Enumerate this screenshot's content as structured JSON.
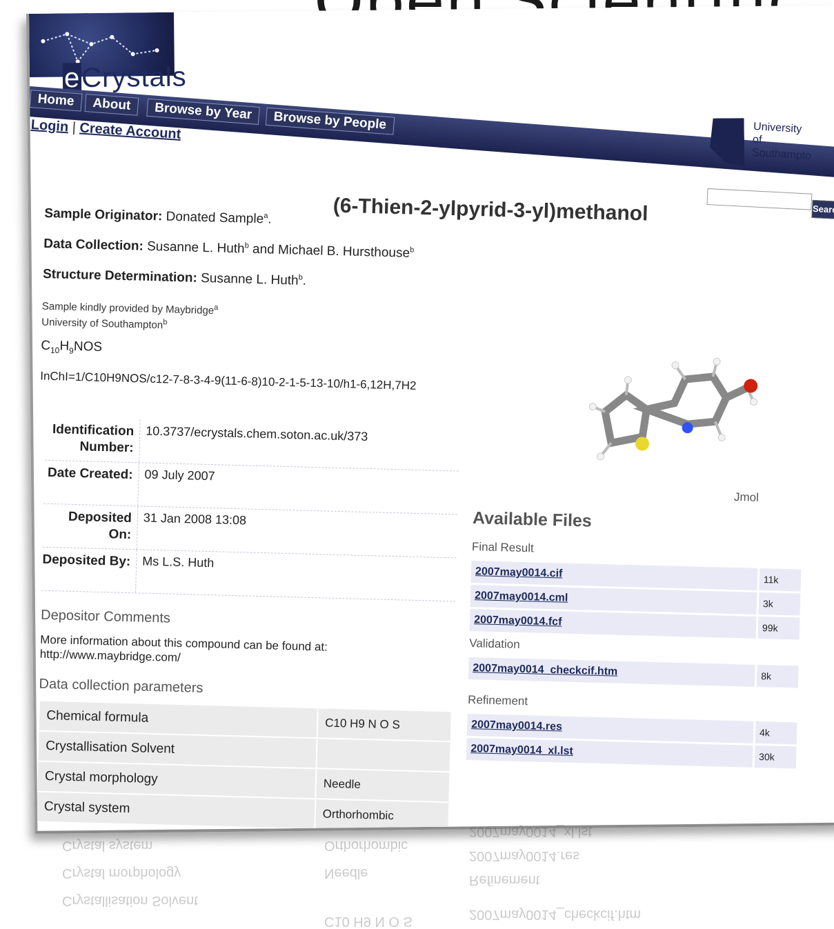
{
  "slide_title": "Open Scientific",
  "site": {
    "logo_text": "Crystals",
    "logo_e": "e"
  },
  "nav": [
    "Home",
    "About",
    "Browse by Year",
    "Browse by People"
  ],
  "account": {
    "login": "Login",
    "separator": "|",
    "create": "Create Account"
  },
  "university": {
    "line1": "University",
    "line2": "of Southampto"
  },
  "search": {
    "button": "Search",
    "placeholder": ""
  },
  "compound_title": "(6-Thien-2-ylpyrid-3-yl)methanol",
  "sample": {
    "originator_label": "Sample Originator:",
    "originator_value": "Donated Sample",
    "originator_sup": "a",
    "collection_label": "Data Collection:",
    "collection_value1": "Susanne L. Huth",
    "collection_sup1": "b",
    "collection_and": "and Michael B. Hursthouse",
    "collection_sup2": "b",
    "structure_label": "Structure Determination:",
    "structure_value": "Susanne L. Huth",
    "structure_sup": "b",
    "affil1": "Sample kindly provided by Maybridge",
    "affil1_sup": "a",
    "affil2": "University of Southampton",
    "affil2_sup": "b"
  },
  "formula": {
    "c": "C",
    "c_n": "10",
    "h": "H",
    "h_n": "9",
    "rest": "NOS"
  },
  "inchi": "InChI=1/C10H9NOS/c12-7-8-3-4-9(11-6-8)10-2-1-5-13-10/h1-6,12H,7H2",
  "meta": [
    {
      "key": "Identification Number:",
      "value": "10.3737/ecrystals.chem.soton.ac.uk/373"
    },
    {
      "key": "Date Created:",
      "value": "09 July 2007"
    },
    {
      "key": "Deposited On:",
      "value": "31 Jan 2008 13:08"
    },
    {
      "key": "Deposited By:",
      "value": "Ms L.S. Huth"
    }
  ],
  "depositor": {
    "heading": "Depositor Comments",
    "body": "More information about this compound can be found at: http://www.maybridge.com/"
  },
  "data_collection": {
    "heading": "Data collection parameters",
    "rows": [
      {
        "label": "Chemical formula",
        "value": "C10 H9 N O S"
      },
      {
        "label": "Crystallisation Solvent",
        "value": ""
      },
      {
        "label": "Crystal morphology",
        "value": "Needle"
      },
      {
        "label": "Crystal system",
        "value": "Orthorhombic"
      }
    ]
  },
  "jmol_label": "Jmol",
  "files": {
    "heading": "Available Files",
    "groups": [
      {
        "name": "Final Result",
        "items": [
          {
            "file": "2007may0014.cif",
            "size": "11k"
          },
          {
            "file": "2007may0014.cml",
            "size": "3k"
          },
          {
            "file": "2007may0014.fcf",
            "size": "99k"
          }
        ]
      },
      {
        "name": "Validation",
        "items": [
          {
            "file": "2007may0014_checkcif.htm",
            "size": "8k"
          }
        ]
      },
      {
        "name": "Refinement",
        "items": [
          {
            "file": "2007may0014.res",
            "size": "4k"
          },
          {
            "file": "2007may0014_xl.lst",
            "size": "30k"
          }
        ]
      }
    ]
  }
}
